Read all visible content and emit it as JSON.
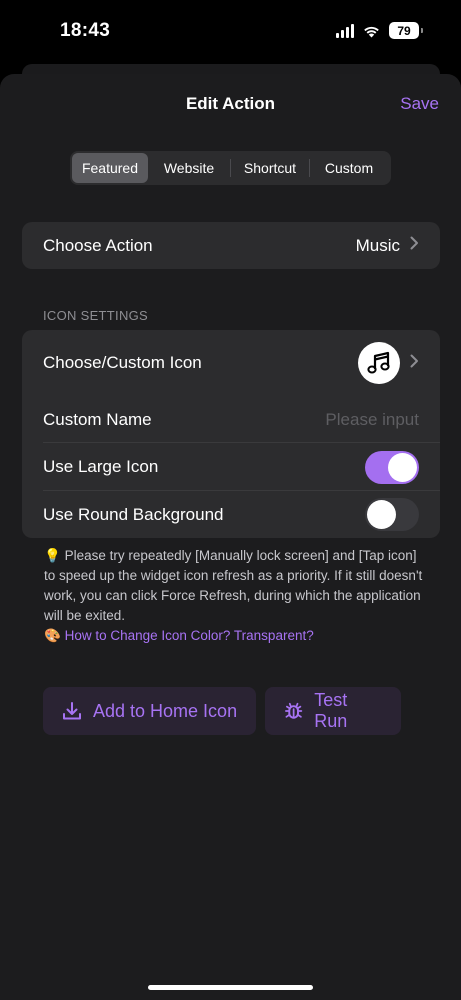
{
  "status_bar": {
    "time": "18:43",
    "battery": "79"
  },
  "nav": {
    "title": "Edit Action",
    "save_label": "Save"
  },
  "segments": [
    "Featured",
    "Website",
    "Shortcut",
    "Custom"
  ],
  "choose_action": {
    "label": "Choose Action",
    "value": "Music"
  },
  "icon_settings": {
    "header": "ICON SETTINGS",
    "choose_icon_label": "Choose/Custom Icon",
    "choose_icon_glyph": "music-note-icon",
    "custom_name_label": "Custom Name",
    "custom_name_placeholder": "Please input",
    "large_icon_label": "Use Large Icon",
    "large_icon_on": true,
    "round_bg_label": "Use Round Background",
    "round_bg_on": false
  },
  "tip": {
    "emoji": "💡",
    "text": "Please try repeatedly [Manually lock screen] and [Tap icon] to speed up the widget icon refresh as a priority. If it still doesn't work, you can click Force Refresh, during which the application will be exited.",
    "link_emoji": "🎨",
    "link_text": "How to Change Icon Color? Transparent?"
  },
  "buttons": {
    "add_home": "Add to Home Icon",
    "test_run": "Test Run"
  },
  "colors": {
    "accent": "#a773f3",
    "toggle_on": "#a46ff0",
    "card": "#2c2c2e",
    "sheet": "#1c1c1e"
  }
}
